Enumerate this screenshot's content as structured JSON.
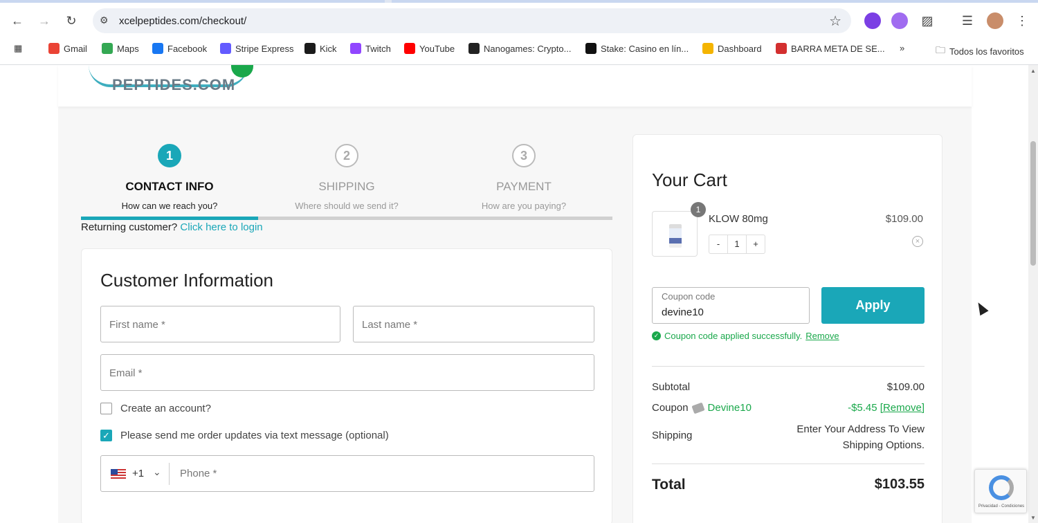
{
  "browser": {
    "url": "xcelpeptides.com/checkout/",
    "bookmarks": [
      "Gmail",
      "Maps",
      "Facebook",
      "Stripe Express",
      "Kick",
      "Twitch",
      "YouTube",
      "Nanogames: Crypto...",
      "Stake: Casino en lín...",
      "Dashboard",
      "BARRA META DE SE..."
    ],
    "all_bookmarks": "Todos los favoritos",
    "colors": {
      "accent": "#1aa7b8",
      "success": "#1aa84b"
    }
  },
  "logo": {
    "text": "PEPTIDES.COM"
  },
  "steps": [
    {
      "num": "1",
      "title": "CONTACT INFO",
      "sub": "How can we reach you?"
    },
    {
      "num": "2",
      "title": "SHIPPING",
      "sub": "Where should we send it?"
    },
    {
      "num": "3",
      "title": "PAYMENT",
      "sub": "How are you paying?"
    }
  ],
  "returning": {
    "text": "Returning customer?",
    "link": "Click here to login"
  },
  "form": {
    "title": "Customer Information",
    "first_name": "First name *",
    "last_name": "Last name *",
    "email": "Email *",
    "create_account": "Create an account?",
    "sms_updates": "Please send me order updates via text message (optional)",
    "phone_code": "+1",
    "phone": "Phone *"
  },
  "cart": {
    "title": "Your Cart",
    "item_qty_badge": "1",
    "item_name": "KLOW 80mg",
    "item_price": "$109.00",
    "stepper": {
      "minus": "-",
      "value": "1",
      "plus": "+"
    },
    "coupon_label": "Coupon code",
    "coupon_value": "devine10",
    "apply": "Apply",
    "coupon_ok": "Coupon code applied successfully.",
    "coupon_remove": "Remove",
    "subtotal_label": "Subtotal",
    "subtotal_value": "$109.00",
    "coupon_row_label": "Coupon",
    "coupon_code": "Devine10",
    "coupon_discount": "-$5.45",
    "coupon_remove_bracket": "[Remove]",
    "shipping_label": "Shipping",
    "shipping_value_1": "Enter Your Address To View",
    "shipping_value_2": "Shipping Options.",
    "total_label": "Total",
    "total_value": "$103.55"
  },
  "recaptcha": {
    "text": "Privacidad - Condiciones"
  }
}
